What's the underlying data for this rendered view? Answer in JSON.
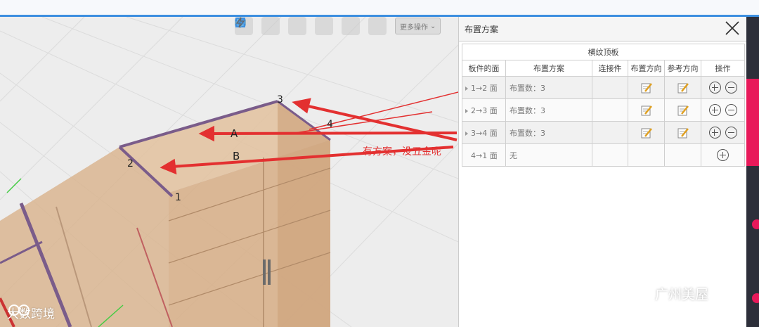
{
  "toolbar": {
    "more_ops": "更多操作",
    "icons": [
      "box-icon",
      "target-icon",
      "cube-icon",
      "copy-icon",
      "fullscreen-icon",
      "lightning-icon"
    ]
  },
  "viewport": {
    "point_labels": [
      "3",
      "4",
      "2",
      "1"
    ],
    "arrow_labels": [
      "A",
      "B"
    ],
    "annotation": "有方案，没五金呢"
  },
  "panel": {
    "title": "布置方案",
    "group_header": "横纹顶板",
    "columns": [
      "板件的面",
      "布置方案",
      "连接件",
      "布置方向",
      "参考方向",
      "操作"
    ],
    "rows": [
      {
        "face": "1→2 面",
        "plan": "布置数：3",
        "has_tri": true,
        "editable": true
      },
      {
        "face": "2→3 面",
        "plan": "布置数：3",
        "has_tri": true,
        "editable": true
      },
      {
        "face": "3→4 面",
        "plan": "布置数：3",
        "has_tri": true,
        "editable": true
      },
      {
        "face": "4→1 面",
        "plan": "无",
        "has_tri": false,
        "editable": false
      }
    ]
  },
  "watermarks": {
    "left": "大数跨境",
    "right": "广州美屋"
  },
  "colors": {
    "accent_blue": "#3d8fe0",
    "annotation_red": "#e33030",
    "sidebar_pink": "#e8195a"
  }
}
